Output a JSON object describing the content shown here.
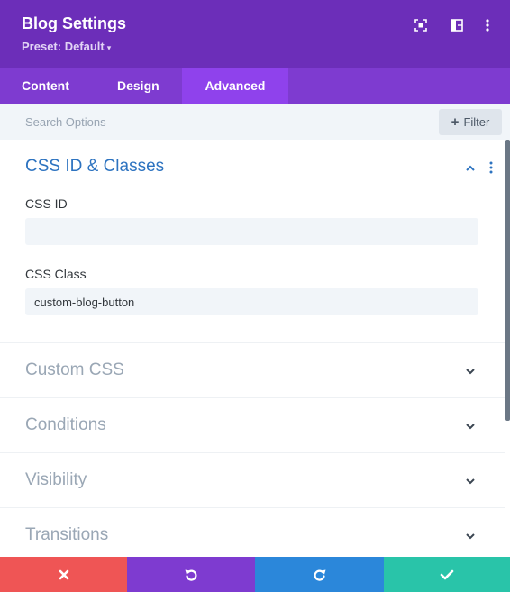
{
  "header": {
    "title": "Blog Settings",
    "preset_label": "Preset: Default",
    "caret": "▾",
    "icons": [
      "focus-icon",
      "split-view-icon",
      "more-options-icon"
    ],
    "bg_color": "#6c2eb9"
  },
  "tabs": [
    {
      "label": "Content",
      "active": false
    },
    {
      "label": "Design",
      "active": false
    },
    {
      "label": "Advanced",
      "active": true
    }
  ],
  "search": {
    "placeholder": "Search Options",
    "filter_label": "Filter",
    "filter_icon": "+"
  },
  "sections": {
    "open": {
      "title": "CSS ID & Classes",
      "fields": [
        {
          "label": "CSS ID",
          "value": ""
        },
        {
          "label": "CSS Class",
          "value": "custom-blog-button"
        }
      ]
    },
    "closed": [
      {
        "title": "Custom CSS"
      },
      {
        "title": "Conditions"
      },
      {
        "title": "Visibility"
      },
      {
        "title": "Transitions"
      }
    ]
  },
  "footer": {
    "buttons": [
      {
        "name": "discard",
        "icon": "close-icon",
        "color": "#ef5555"
      },
      {
        "name": "undo",
        "icon": "undo-icon",
        "color": "#7e3bd0"
      },
      {
        "name": "redo",
        "icon": "redo-icon",
        "color": "#2b87da"
      },
      {
        "name": "save",
        "icon": "checkmark-icon",
        "color": "#29c4a9"
      }
    ]
  }
}
